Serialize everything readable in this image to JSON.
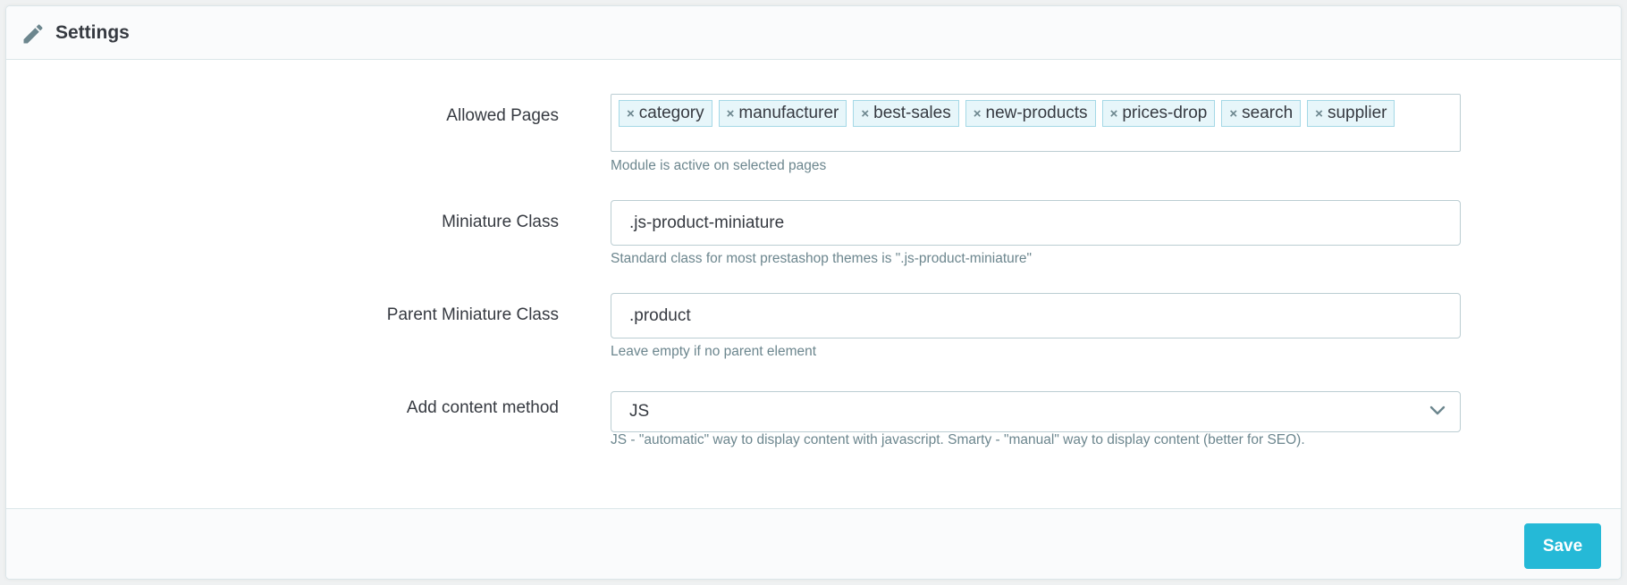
{
  "panel": {
    "title": "Settings",
    "icon": "pencil-icon"
  },
  "fields": {
    "allowed_pages": {
      "label": "Allowed Pages",
      "tags": [
        "category",
        "manufacturer",
        "best-sales",
        "new-products",
        "prices-drop",
        "search",
        "supplier"
      ],
      "tag_remove_glyph": "×",
      "help": "Module is active on selected pages"
    },
    "miniature_class": {
      "label": "Miniature Class",
      "value": ".js-product-miniature",
      "help": "Standard class for most prestashop themes is \".js-product-miniature\""
    },
    "parent_miniature_class": {
      "label": "Parent Miniature Class",
      "value": ".product",
      "help": "Leave empty if no parent element"
    },
    "add_content_method": {
      "label": "Add content method",
      "selected": "JS",
      "help": "JS - \"automatic\" way to display content with javascript. Smarty - \"manual\" way to display content (better for SEO)."
    }
  },
  "footer": {
    "save_label": "Save"
  },
  "colors": {
    "accent": "#25b9d7",
    "tag_bg": "#e7f6fa",
    "help_text": "#6c868e"
  }
}
